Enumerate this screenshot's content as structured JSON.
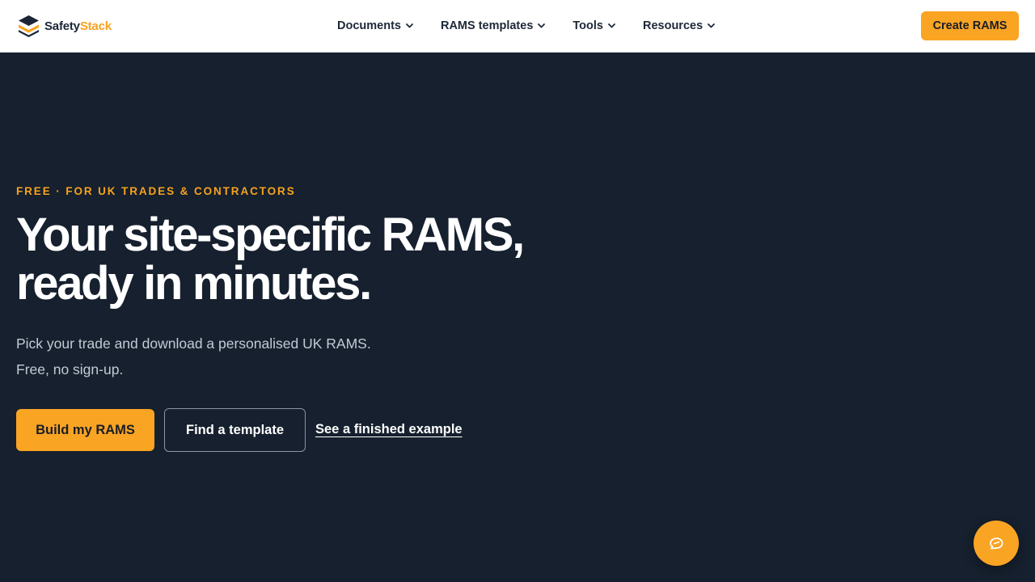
{
  "brand": {
    "name_part1": "Safety",
    "name_part2": "Stack",
    "logo_icon": "layered-stack-icon"
  },
  "nav": {
    "items": [
      {
        "label": "Documents",
        "icon": "chevron-down-icon"
      },
      {
        "label": "RAMS templates",
        "icon": "chevron-down-icon"
      },
      {
        "label": "Tools",
        "icon": "chevron-down-icon"
      },
      {
        "label": "Resources",
        "icon": "chevron-down-icon"
      }
    ],
    "cta_label": "Create RAMS"
  },
  "hero": {
    "eyebrow": "FREE · FOR UK TRADES & CONTRACTORS",
    "headline_line1": "Your site-specific RAMS,",
    "headline_line2": "ready in minutes.",
    "sub_line1": "Pick your trade and download a personalised UK RAMS.",
    "sub_line2": "Free, no sign-up.",
    "primary_label": "Build my RAMS",
    "secondary_label": "Find a template",
    "link_label": "See a finished example"
  },
  "chat": {
    "icon": "chat-bubble-icon"
  },
  "colors": {
    "accent": "#faa424",
    "hero_bg": "#16202e",
    "topbar_bg": "#ffffff",
    "text_dark": "#1e2838",
    "text_muted": "#c3cad4"
  }
}
